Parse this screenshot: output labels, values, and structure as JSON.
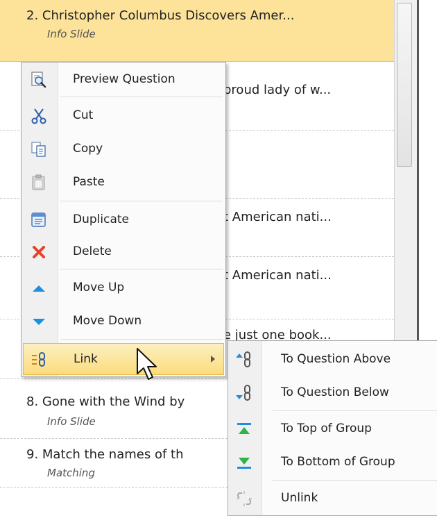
{
  "list": {
    "rows": [
      {
        "title": "2. Christopher Columbus Discovers Amer...",
        "subtitle": "Info Slide"
      },
      {
        "fragment": "proud lady of w..."
      },
      {
        "fragment": "t American nati..."
      },
      {
        "fragment": "t American nati..."
      },
      {
        "fragment": "e just one book..."
      },
      {
        "title": "8. Gone with the Wind by",
        "subtitle": "Info Slide"
      },
      {
        "title": "9. Match the names of th",
        "subtitle": "Matching"
      }
    ]
  },
  "context_menu": {
    "items": [
      {
        "label": "Preview Question",
        "icon": "preview-icon"
      },
      {
        "label": "Cut",
        "icon": "scissors-icon"
      },
      {
        "label": "Copy",
        "icon": "copy-icon"
      },
      {
        "label": "Paste",
        "icon": "paste-icon"
      },
      {
        "label": "Duplicate",
        "icon": "duplicate-icon"
      },
      {
        "label": "Delete",
        "icon": "delete-icon"
      },
      {
        "label": "Move Up",
        "icon": "triangle-up-icon"
      },
      {
        "label": "Move Down",
        "icon": "triangle-down-icon"
      },
      {
        "label": "Link",
        "icon": "link-icon",
        "has_submenu": true,
        "highlighted": true
      }
    ]
  },
  "link_submenu": {
    "items": [
      {
        "label": "To Question Above",
        "icon": "link-up-icon"
      },
      {
        "label": "To Question Below",
        "icon": "link-down-icon"
      },
      {
        "label": "To Top of Group",
        "icon": "to-top-icon"
      },
      {
        "label": "To Bottom of Group",
        "icon": "to-bottom-icon"
      },
      {
        "label": "Unlink",
        "icon": "unlink-icon"
      }
    ]
  },
  "colors": {
    "selected_row": "#fde39a",
    "menu_hover": "#fbdc7d",
    "accent_blue": "#1e8fe0",
    "delete_red": "#e8402a",
    "group_green": "#2fb34a"
  }
}
